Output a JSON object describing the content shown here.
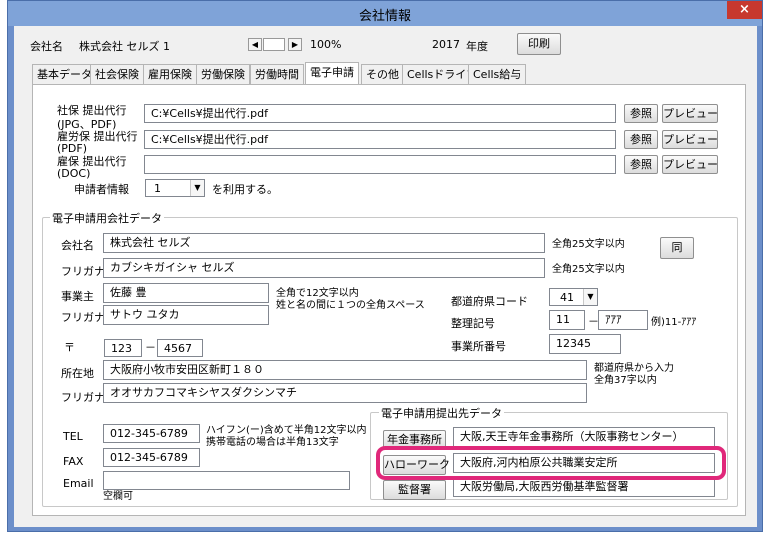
{
  "window": {
    "title": "会社情報",
    "close_glyph": "×"
  },
  "header": {
    "company_label": "会社名",
    "company_name": "株式会社 セルズ 1",
    "zoom": "100%",
    "year": "2017",
    "year_label": "年度",
    "print_button": "印刷"
  },
  "tabs": [
    {
      "label": "基本データ"
    },
    {
      "label": "社会保険"
    },
    {
      "label": "雇用保険"
    },
    {
      "label": "労働保険"
    },
    {
      "label": "労働時間"
    },
    {
      "label": "電子申請",
      "active": true
    },
    {
      "label": "その他"
    },
    {
      "label": "Cellsドライブ"
    },
    {
      "label": "Cells給与"
    }
  ],
  "proxy": {
    "rows": [
      {
        "label1": "社保 提出代行",
        "label2": "(JPG、PDF)",
        "value": "C:¥Cells¥提出代行.pdf"
      },
      {
        "label1": "雇労保 提出代行",
        "label2": "(PDF)",
        "value": "C:¥Cells¥提出代行.pdf"
      },
      {
        "label1": "雇保 提出代行",
        "label2": "(DOC)",
        "value": ""
      }
    ],
    "browse_label": "参照",
    "preview_label": "プレビュー",
    "applicant_label": "申請者情報",
    "applicant_value": "1",
    "applicant_suffix": "を利用する。"
  },
  "company_group": {
    "title": "電子申請用会社データ",
    "company_name_label": "会社名",
    "company_name": "株式会社 セルズ",
    "company_name_note": "全角25文字以内",
    "same_button": "同",
    "furigana_label": "フリガナ",
    "company_kana": "カブシキガイシャ セルズ",
    "company_kana_note": "全角25文字以内",
    "owner_label": "事業主",
    "owner_name": "佐藤 豊",
    "owner_note1": "全角で12文字以内",
    "owner_note2": "姓と名の間に１つの全角スペース",
    "owner_kana": "サトウ ユタカ",
    "pref_code_label": "都道府県コード",
    "pref_code": "41",
    "ref_sign_label": "整理記号",
    "ref_sign_num": "11",
    "ref_sign_dash": "－",
    "ref_sign_kana": "ｱｱｱ",
    "ref_sign_example": "例)11-ｱｱｱ",
    "office_num_label": "事業所番号",
    "office_num": "12345",
    "postal_label": "〒",
    "postal1": "123",
    "postal_dash": "－",
    "postal2": "4567",
    "address_label": "所在地",
    "address": "大阪府小牧市安田区新町１８０",
    "address_note1": "都道府県から入力",
    "address_note2": "全角37字以内",
    "address_kana": "オオサカフコマキシヤスダクシンマチ",
    "tel_label": "TEL",
    "tel": "012-345-6789",
    "tel_note1": "ハイフン(ー)含めて半角12文字以内",
    "tel_note2": "携帯電話の場合は半角13文字",
    "fax_label": "FAX",
    "fax": "012-345-6789",
    "email_label": "Email",
    "email": "",
    "email_note": "空欄可"
  },
  "submit_group": {
    "title": "電子申請用提出先データ",
    "rows": [
      {
        "button": "年金事務所",
        "value": "大阪,天王寺年金事務所（大阪事務センター）"
      },
      {
        "button": "ハローワーク",
        "value": "大阪府,河内柏原公共職業安定所"
      },
      {
        "button": "監督署",
        "value": "大阪労働局,大阪西労働基準監督署"
      }
    ]
  },
  "colors": {
    "highlight": "#e0287a",
    "titlebar": "#7fa3d8",
    "close": "#c7382e"
  }
}
